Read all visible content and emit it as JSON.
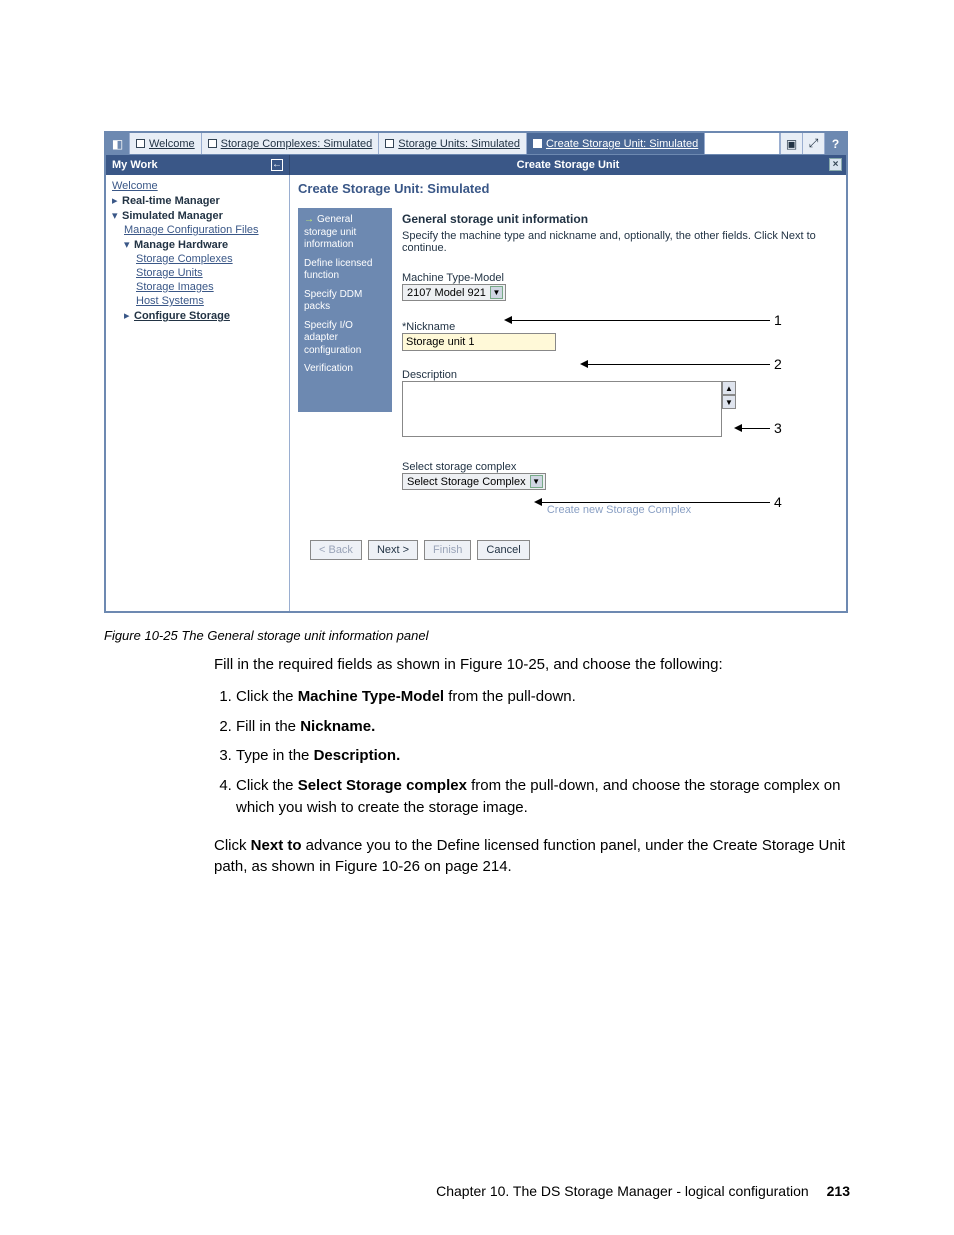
{
  "tabs": {
    "welcome": "Welcome",
    "storage_complexes": "Storage Complexes: Simulated",
    "storage_units": "Storage Units: Simulated",
    "create_storage_unit": "Create Storage Unit: Simulated"
  },
  "header": {
    "left": "My Work",
    "right": "Create Storage Unit"
  },
  "sidebar": {
    "welcome": "Welcome",
    "realtime": "Real-time Manager",
    "simulated": "Simulated Manager",
    "manage_config": "Manage Configuration Files",
    "manage_hw": "Manage Hardware",
    "storage_complexes": "Storage Complexes",
    "storage_units": "Storage Units",
    "storage_images": "Storage Images",
    "host_systems": "Host Systems",
    "configure_storage": "Configure Storage"
  },
  "main": {
    "title": "Create Storage Unit: Simulated",
    "steps": {
      "s1": "General storage unit information",
      "s2": "Define licensed function",
      "s3": "Specify DDM packs",
      "s4": "Specify I/O adapter configuration",
      "s5": "Verification"
    },
    "form": {
      "heading": "General storage unit information",
      "desc": "Specify the machine type and nickname and, optionally, the other fields. Click Next to continue.",
      "machine_label": "Machine Type-Model",
      "machine_value": "2107 Model 921",
      "nickname_label": "*Nickname",
      "nickname_value": "Storage unit 1",
      "desc_label": "Description",
      "select_complex_label": "Select storage complex",
      "select_complex_value": "Select Storage Complex",
      "create_new": "Create new Storage Complex"
    },
    "buttons": {
      "back": "< Back",
      "next": "Next >",
      "finish": "Finish",
      "cancel": "Cancel"
    }
  },
  "callouts": {
    "n1": "1",
    "n2": "2",
    "n3": "3",
    "n4": "4"
  },
  "caption": "Figure 10-25   The General storage unit information panel",
  "body": {
    "intro": "Fill in the required fields as shown in Figure 10-25, and choose the following:",
    "li1a": "Click the ",
    "li1b": "Machine Type-Model",
    "li1c": " from the pull-down.",
    "li2a": "Fill in the ",
    "li2b": "Nickname.",
    "li3a": "Type in the ",
    "li3b": "Description.",
    "li4a": "Click the ",
    "li4b": "Select Storage complex",
    "li4c": " from the pull-down, and choose the storage complex on which you wish to create the storage image.",
    "outro1": "Click ",
    "outro_b": "Next to",
    "outro2": " advance you to the Define licensed function panel, under the Create Storage Unit path, as shown in Figure 10-26 on page 214."
  },
  "footer": {
    "chapter": "Chapter 10. The DS Storage Manager - logical configuration",
    "page": "213"
  }
}
